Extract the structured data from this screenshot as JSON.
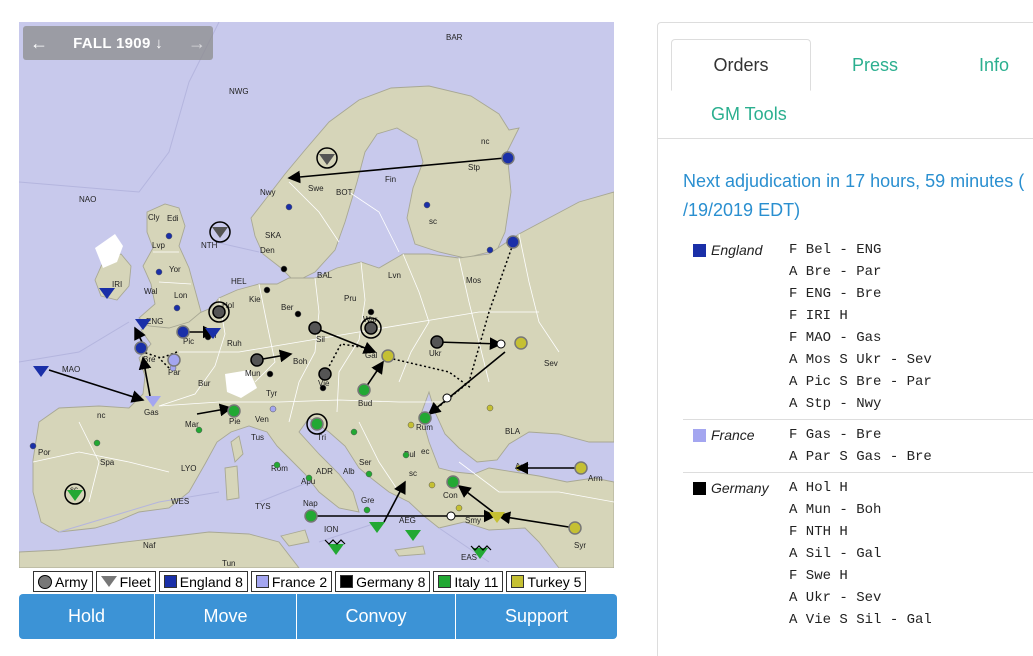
{
  "map": {
    "season": "FALL 1909",
    "prev_icon": "arrow-left-icon",
    "next_icon": "arrow-right-icon",
    "season_icon": "arrow-down-icon",
    "labels": {
      "BAR": "BAR",
      "NWG": "NWG",
      "NAO": "NAO",
      "Nwy": "Nwy",
      "Swe": "Swe",
      "BOT": "BOT",
      "Fin": "Fin",
      "Stp": "Stp",
      "nc_stp": "nc",
      "sc_stp": "sc",
      "Cly": "Cly",
      "Edi": "Edi",
      "Lvp": "Lvp",
      "Yor": "Yor",
      "NTH": "NTH",
      "SKA": "SKA",
      "Den": "Den",
      "IRI": "IRI",
      "Wal": "Wal",
      "Lon": "Lon",
      "HEL": "HEL",
      "BAL": "BAL",
      "Lvn": "Lvn",
      "Mos": "Mos",
      "ENG": "ENG",
      "Hol": "Hol",
      "Kie": "Kie",
      "Ber": "Ber",
      "Pru": "Pru",
      "War": "War",
      "Bel": "Bel",
      "Pic": "Pic",
      "Bre": "Bre",
      "Par": "Par",
      "Ruh": "Ruh",
      "Sil": "Sil",
      "Gal": "Gal",
      "Ukr": "Ukr",
      "MAO": "MAO",
      "Mun": "Mun",
      "Boh": "Boh",
      "Vie": "Vie",
      "Sev": "Sev",
      "Bur": "Bur",
      "Gas": "Gas",
      "Tyr": "Tyr",
      "Bud": "Bud",
      "Rum": "Rum",
      "nc_spa": "nc",
      "Mar": "Mar",
      "Pie": "Pie",
      "Ven": "Ven",
      "Tri": "Tri",
      "BLA": "BLA",
      "Por": "Por",
      "Spa": "Spa",
      "Tus": "Tus",
      "Ser": "Ser",
      "Bul": "Bul",
      "ec": "ec",
      "Arm": "Arm",
      "Ank": "Ank",
      "LYO": "LYO",
      "Rom": "Rom",
      "ADR": "ADR",
      "Alb": "Alb",
      "sc_bul": "sc",
      "Apu": "Apu",
      "Con": "Con",
      "WES": "WES",
      "TYS": "TYS",
      "Nap": "Nap",
      "Gre": "Gre",
      "AEG": "AEG",
      "Smy": "Smy",
      "sc_spa": "sc",
      "ION": "ION",
      "EAS": "EAS",
      "Syr": "Syr",
      "Naf": "Naf",
      "Tun": "Tun"
    }
  },
  "legend": {
    "army": "Army",
    "fleet": "Fleet",
    "nations": [
      {
        "label": "England 8",
        "color": "#1a2fa8"
      },
      {
        "label": "France 2",
        "color": "#a4a6f0"
      },
      {
        "label": "Germany 8",
        "color": "#000000"
      },
      {
        "label": "Italy 11",
        "color": "#22a833"
      },
      {
        "label": "Turkey 5",
        "color": "#c5c033"
      }
    ]
  },
  "actions": {
    "hold": "Hold",
    "move": "Move",
    "convoy": "Convoy",
    "support": "Support"
  },
  "tabs": {
    "orders": "Orders",
    "press": "Press",
    "info": "Info",
    "gm_tools": "GM Tools"
  },
  "adjudication": "Next adjudication in 17 hours, 59 minutes (/19/2019 EDT)",
  "adjudication_lines": [
    "Next adjudication in 17 hours, 59 minutes (",
    "/19/2019 EDT)"
  ],
  "orders": [
    {
      "nation": "England",
      "color": "#1a2fa8",
      "lines": [
        "F Bel - ENG",
        "A Bre - Par",
        "F ENG - Bre",
        "F IRI H",
        "F MAO - Gas",
        "A Mos S Ukr - Sev",
        "A Pic S Bre - Par",
        "A Stp - Nwy"
      ]
    },
    {
      "nation": "France",
      "color": "#a4a6f0",
      "lines": [
        "F Gas - Bre",
        "A Par S Gas - Bre"
      ]
    },
    {
      "nation": "Germany",
      "color": "#000000",
      "lines": [
        "A Hol H",
        "A Mun - Boh",
        "F NTH H",
        "A Sil - Gal",
        "F Swe H",
        "A Ukr - Sev",
        "A Vie S Sil - Gal"
      ]
    }
  ]
}
